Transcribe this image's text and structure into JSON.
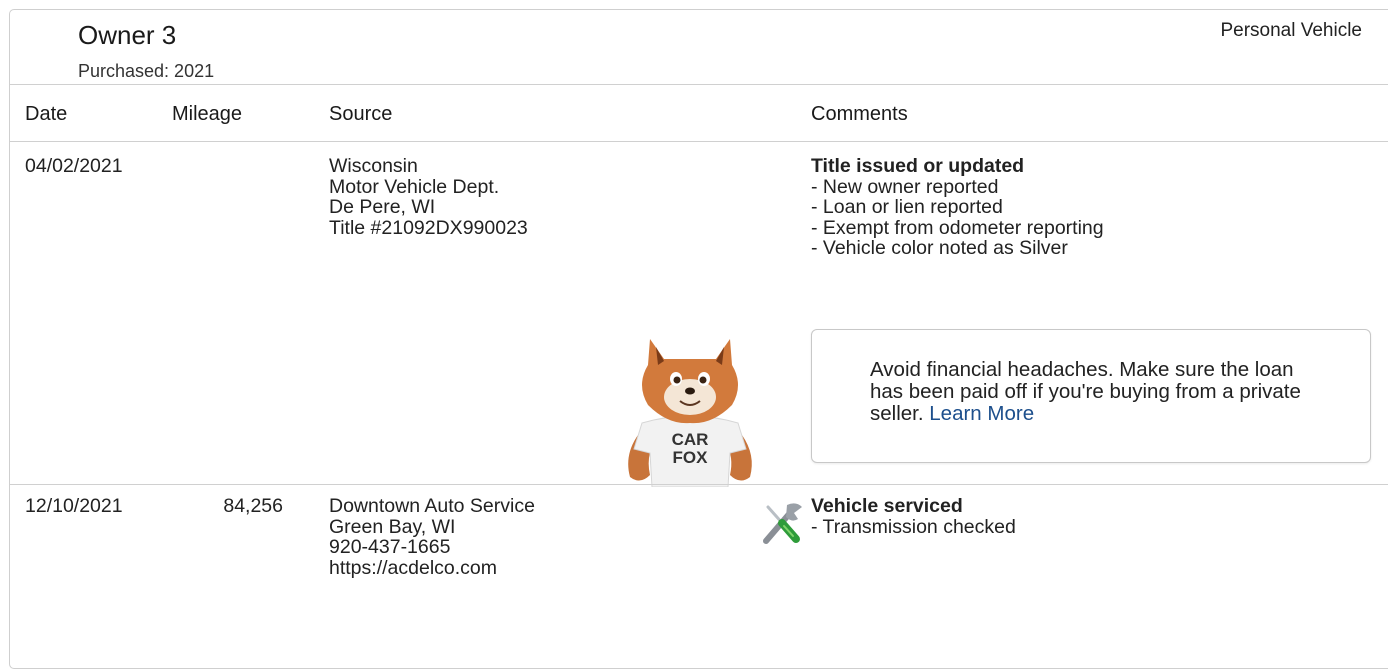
{
  "owner": {
    "title": "Owner 3",
    "purchased": "Purchased: 2021",
    "vehicle_type": "Personal Vehicle"
  },
  "table": {
    "headers": [
      "Date",
      "Mileage",
      "Source",
      "Comments"
    ],
    "rows": [
      {
        "date": "04/02/2021",
        "mileage": "",
        "source": [
          "Wisconsin",
          "Motor Vehicle Dept.",
          "De Pere, WI",
          "Title #21092DX990023"
        ],
        "comment_title": "Title issued or updated",
        "comment_items": [
          "- New owner reported",
          "- Loan or lien reported",
          "- Exempt from odometer reporting",
          "- Vehicle color noted as Silver"
        ]
      },
      {
        "date": "12/10/2021",
        "mileage": "84,256",
        "source": [
          "Downtown Auto Service",
          "Green Bay, WI",
          "920-437-1665",
          "https://acdelco.com"
        ],
        "comment_title": "Vehicle serviced",
        "comment_items": [
          "- Transmission checked"
        ]
      }
    ]
  },
  "tip": {
    "text": "Avoid financial headaches. Make sure the loan has been paid off if you're buying from a private seller.",
    "link_label": "Learn More"
  },
  "mascot": {
    "shirt_line1": "CAR",
    "shirt_line2": "FOX"
  },
  "icons": {
    "service": "wrench-screwdriver-icon",
    "mascot": "carfox-mascot"
  },
  "colors": {
    "link": "#1d4f8c",
    "border": "#d0d0d0"
  }
}
